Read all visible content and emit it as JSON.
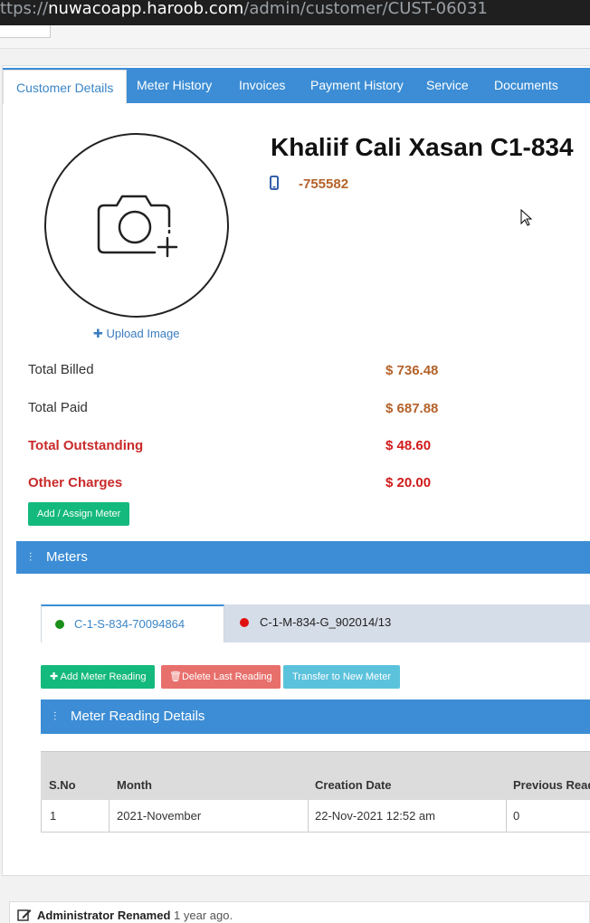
{
  "browser": {
    "url_scheme": "ttps://",
    "url_host": "nuwacoapp.haroob.com",
    "url_path": "/admin/customer/CUST-06031"
  },
  "tabs": [
    {
      "label": "Customer Details",
      "active": true
    },
    {
      "label": "Meter History"
    },
    {
      "label": "Invoices"
    },
    {
      "label": "Payment History"
    },
    {
      "label": "Service"
    },
    {
      "label": "Documents"
    }
  ],
  "customer": {
    "name": "Khaliif Cali Xasan C1-834",
    "phone": "-755582",
    "upload_label": "Upload Image",
    "avatar_icon": "camera-add-icon",
    "phone_icon": "mobile-phone-icon"
  },
  "summary": {
    "total_billed_label": "Total Billed",
    "total_billed": "$ 736.48",
    "total_paid_label": "Total Paid",
    "total_paid": "$ 687.88",
    "total_outstanding_label": "Total Outstanding",
    "total_outstanding": "$ 48.60",
    "other_charges_label": "Other Charges",
    "other_charges": "$ 20.00"
  },
  "actions": {
    "assign_meter": "Add / Assign Meter",
    "add_reading": "Add Meter Reading",
    "delete_reading": "Delete Last Reading",
    "transfer_meter": "Transfer to New Meter"
  },
  "meters": {
    "title": "Meters",
    "items": [
      {
        "label": "C-1-S-834-70094864",
        "status_color": "#1a8f1a",
        "active": true
      },
      {
        "label": "C-1-M-834-G_902014/13",
        "status_color": "#e01010",
        "active": false
      }
    ]
  },
  "readings": {
    "title": "Meter Reading Details",
    "columns": [
      "S.No",
      "Month",
      "Creation Date",
      "Previous Read"
    ],
    "rows": [
      [
        "1",
        "2021-November",
        "22-Nov-2021 12:52 am",
        "0"
      ]
    ]
  },
  "activity": {
    "actor": "Administrator",
    "action": "Renamed",
    "ago": "1 year ago."
  },
  "colors": {
    "primary": "#3c8dd5",
    "amount": "#b4622a",
    "alert": "#d11a1a",
    "success": "#14b97d"
  }
}
